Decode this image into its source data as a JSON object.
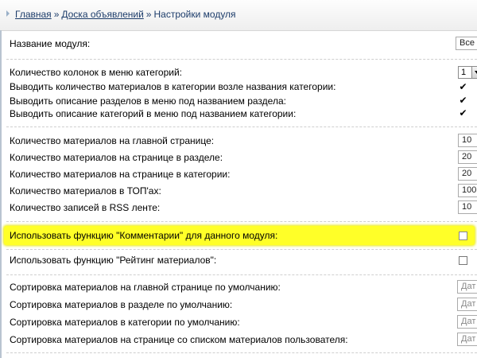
{
  "breadcrumb": {
    "home": "Главная",
    "sep": "»",
    "board": "Доска объявлений",
    "current": "Настройки модуля"
  },
  "module_name": {
    "label": "Название модуля:",
    "value": "Все"
  },
  "categories_block": {
    "columns": {
      "label": "Количество колонок в меню категорий:",
      "value": "1"
    },
    "show_count": {
      "label": "Выводить количество материалов в категории возле названия категории:",
      "checked": true
    },
    "section_desc": {
      "label": "Выводить описание разделов в меню под названием раздела:",
      "checked": true
    },
    "category_desc": {
      "label": "Выводить описание категорий в меню под названием категории:",
      "checked": true
    }
  },
  "counts_block": {
    "main_page": {
      "label": "Количество материалов на главной странице:",
      "value": "10"
    },
    "section_page": {
      "label": "Количество материалов на странице в разделе:",
      "value": "20"
    },
    "category_page": {
      "label": "Количество материалов на странице в категории:",
      "value": "20"
    },
    "top": {
      "label": "Количество материалов в ТОП'ах:",
      "value": "100"
    },
    "rss": {
      "label": "Количество записей в RSS ленте:",
      "value": "10"
    }
  },
  "comments": {
    "label": "Использовать функцию \"Комментарии\" для данного модуля:",
    "checked": false
  },
  "rating": {
    "label": "Использовать функцию \"Рейтинг материалов\":",
    "checked": false
  },
  "sorting_block": {
    "main": {
      "label": "Сортировка материалов на главной странице по умолчанию:",
      "placeholder": "Дат"
    },
    "section": {
      "label": "Сортировка материалов в разделе по умолчанию:",
      "placeholder": "Дат"
    },
    "category": {
      "label": "Сортировка материалов в категории по умолчанию:",
      "placeholder": "Дат"
    },
    "user_list": {
      "label": "Сортировка материалов на странице со списком материалов пользователя:",
      "placeholder": "Дат"
    }
  },
  "colors": {
    "highlight": "#ffff28",
    "link": "#1d3d6b",
    "accent_line": "#b9c4d0"
  }
}
